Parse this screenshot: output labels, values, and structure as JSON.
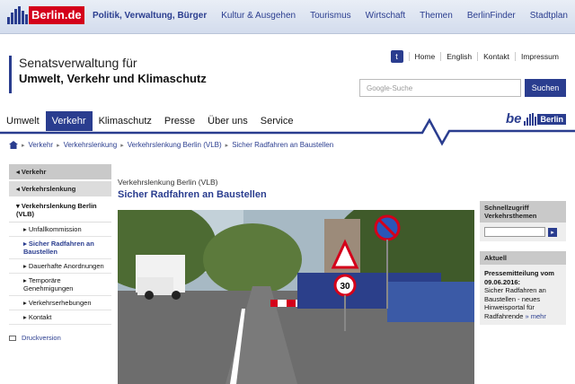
{
  "portal": {
    "logo_text": "Berlin.de",
    "nav": [
      "Politik, Verwaltung, Bürger",
      "Kultur & Ausgehen",
      "Tourismus",
      "Wirtschaft",
      "Themen",
      "BerlinFinder",
      "Stadtplan"
    ]
  },
  "header": {
    "org_line1": "Senatsverwaltung für",
    "org_line2": "Umwelt, Verkehr und Klimaschutz",
    "util_links": [
      "Home",
      "English",
      "Kontakt",
      "Impressum"
    ],
    "search_placeholder": "Google-Suche",
    "search_button": "Suchen"
  },
  "mainnav": {
    "items": [
      "Umwelt",
      "Verkehr",
      "Klimaschutz",
      "Presse",
      "Über uns",
      "Service"
    ],
    "active_index": 1
  },
  "brand": {
    "be": "be",
    "city": "Berlin"
  },
  "breadcrumb": [
    "Verkehr",
    "Verkehrslenkung",
    "Verkehrslenkung Berlin (VLB)",
    "Sicher Radfahren an Baustellen"
  ],
  "sidebar": {
    "section": "Verkehr",
    "subsection": "Verkehrslenkung",
    "current": "Verkehrslenkung Berlin (VLB)",
    "items": [
      "Unfallkommission",
      "Sicher Radfahren an Baustellen",
      "Dauerhafte Anordnungen",
      "Temporäre Genehmigungen",
      "Verkehrserhebungen",
      "Kontakt"
    ],
    "print_label": "Druckversion"
  },
  "content": {
    "kicker": "Verkehrslenkung Berlin (VLB)",
    "title": "Sicher Radfahren an Baustellen"
  },
  "right": {
    "quick_title": "Schnellzugriff Verkehrsthemen",
    "news_title": "Aktuell",
    "news_date": "Pressemitteilung vom 09.06.2016:",
    "news_text": "Sicher Radfahren an Baustellen - neues Hinweisportal für Radfahrende",
    "news_more": "mehr"
  },
  "photo_sign_number": "30",
  "colors": {
    "brand_blue": "#2a3d8f",
    "berlin_red": "#d4001a"
  }
}
